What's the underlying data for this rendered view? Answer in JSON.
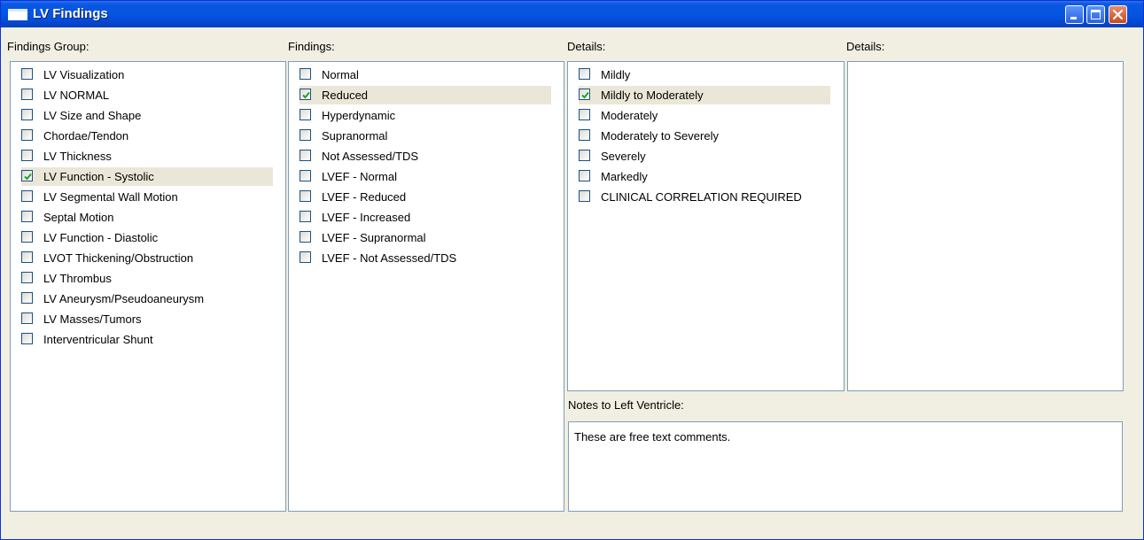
{
  "window": {
    "title": "LV Findings"
  },
  "findings_group": {
    "label": "Findings Group:",
    "items": [
      {
        "label": "LV Visualization",
        "checked": false
      },
      {
        "label": "LV NORMAL",
        "checked": false
      },
      {
        "label": "LV Size and Shape",
        "checked": false
      },
      {
        "label": "Chordae/Tendon",
        "checked": false
      },
      {
        "label": "LV Thickness",
        "checked": false
      },
      {
        "label": "LV Function - Systolic",
        "checked": true
      },
      {
        "label": "LV Segmental Wall Motion",
        "checked": false
      },
      {
        "label": "Septal Motion",
        "checked": false
      },
      {
        "label": "LV Function - Diastolic",
        "checked": false
      },
      {
        "label": "LVOT Thickening/Obstruction",
        "checked": false
      },
      {
        "label": "LV Thrombus",
        "checked": false
      },
      {
        "label": "LV Aneurysm/Pseudoaneurysm",
        "checked": false
      },
      {
        "label": "LV Masses/Tumors",
        "checked": false
      },
      {
        "label": "Interventricular Shunt",
        "checked": false
      }
    ]
  },
  "findings": {
    "label": "Findings:",
    "items": [
      {
        "label": "Normal",
        "checked": false
      },
      {
        "label": "Reduced",
        "checked": true
      },
      {
        "label": "Hyperdynamic",
        "checked": false
      },
      {
        "label": "Supranormal",
        "checked": false
      },
      {
        "label": "Not Assessed/TDS",
        "checked": false
      },
      {
        "label": "LVEF - Normal",
        "checked": false
      },
      {
        "label": "LVEF - Reduced",
        "checked": false
      },
      {
        "label": "LVEF - Increased",
        "checked": false
      },
      {
        "label": "LVEF - Supranormal",
        "checked": false
      },
      {
        "label": "LVEF - Not Assessed/TDS",
        "checked": false
      }
    ]
  },
  "details1": {
    "label": "Details:",
    "items": [
      {
        "label": "Mildly",
        "checked": false
      },
      {
        "label": "Mildly to Moderately",
        "checked": true
      },
      {
        "label": "Moderately",
        "checked": false
      },
      {
        "label": "Moderately to Severely",
        "checked": false
      },
      {
        "label": "Severely",
        "checked": false
      },
      {
        "label": "Markedly",
        "checked": false
      },
      {
        "label": "CLINICAL CORRELATION REQUIRED",
        "checked": false
      }
    ]
  },
  "details2": {
    "label": "Details:",
    "items": []
  },
  "notes": {
    "label": "Notes to Left Ventricle:",
    "value": "These are free text comments."
  },
  "colors": {
    "titlebar": "#0354e0",
    "selection": "#ebe7d8",
    "check": "#21a121",
    "panel_border": "#7f9db9"
  }
}
